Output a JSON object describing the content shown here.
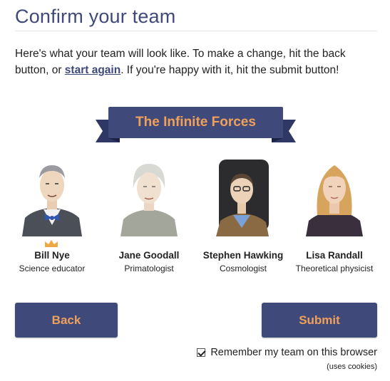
{
  "page": {
    "title": "Confirm your team",
    "intro_before": "Here's what your team will look like. To make a change, hit the back button, or ",
    "intro_link": "start again",
    "intro_after": ". If you're happy with it, hit the submit button!"
  },
  "team": {
    "name": "The Infinite Forces",
    "members": [
      {
        "name": "Bill Nye",
        "role": "Science educator",
        "captain": true,
        "portrait_icon": "bill-nye-portrait"
      },
      {
        "name": "Jane Goodall",
        "role": "Primatologist",
        "captain": false,
        "portrait_icon": "jane-goodall-portrait"
      },
      {
        "name": "Stephen Hawking",
        "role": "Cosmologist",
        "captain": false,
        "portrait_icon": "stephen-hawking-portrait"
      },
      {
        "name": "Lisa Randall",
        "role": "Theoretical physicist",
        "captain": false,
        "portrait_icon": "lisa-randall-portrait"
      }
    ]
  },
  "actions": {
    "back_label": "Back",
    "submit_label": "Submit",
    "remember_label": "Remember my team on this browser",
    "remember_checked": true,
    "cookies_note": "(uses cookies)"
  },
  "colors": {
    "navy": "#3f4a7a",
    "accent_orange": "#f0a05a",
    "banner_dark": "#2a3258"
  }
}
